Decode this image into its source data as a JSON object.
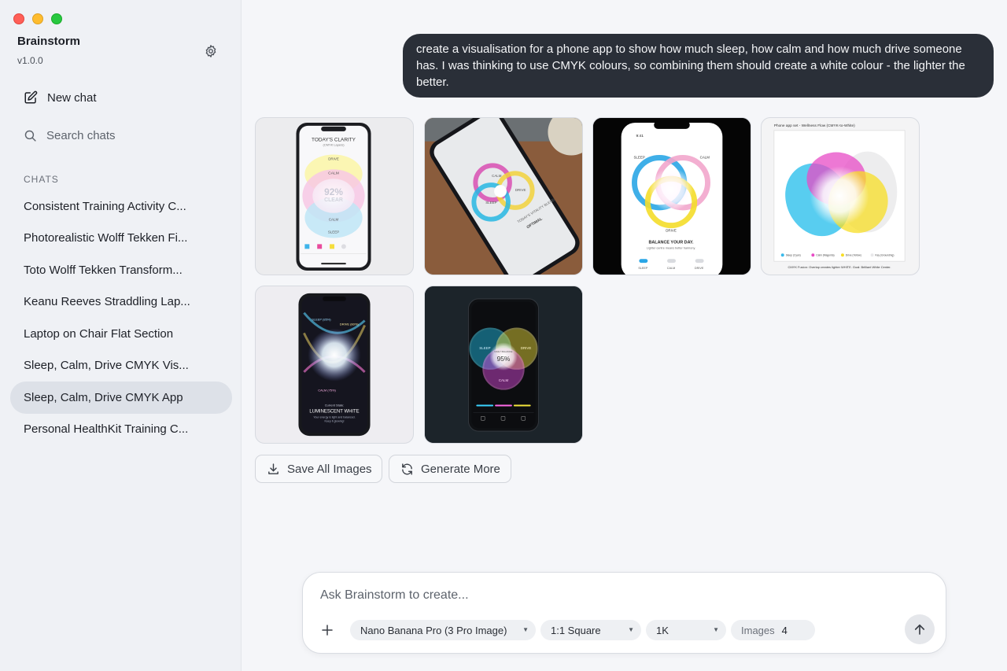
{
  "app": {
    "title": "Brainstorm",
    "version": "v1.0.0"
  },
  "sidebar": {
    "new_chat": "New chat",
    "search_chats": "Search chats",
    "chats_heading": "CHATS",
    "chats": [
      {
        "label": "Consistent Training Activity C..."
      },
      {
        "label": "Photorealistic Wolff Tekken Fi..."
      },
      {
        "label": "Toto Wolff Tekken Transform..."
      },
      {
        "label": "Keanu Reeves Straddling Lap..."
      },
      {
        "label": "Laptop on Chair Flat Section"
      },
      {
        "label": "Sleep, Calm, Drive CMYK Vis..."
      },
      {
        "label": "Sleep, Calm, Drive CMYK App",
        "active": true
      },
      {
        "label": "Personal HealthKit Training C..."
      }
    ]
  },
  "message": {
    "text": "create a visualisation for a phone app to show how much sleep, how calm and how much drive someone has. I was thinking to use CMYK colours, so combining them should create a white colour - the lighter the better."
  },
  "images": {
    "img1": {
      "title": "TODAY'S CLARITY",
      "subtitle": "(CMYK Layers)",
      "drive": "DRIVE",
      "calm": "CALM",
      "value": "92%",
      "value_label": "CLEAR",
      "calm2": "CALM",
      "sleep": "SLEEP"
    },
    "img2": {
      "calm": "CALM",
      "drive": "DRIVE",
      "sleep": "SLEEP",
      "caption": "TODAY'S VITALITY BLEND",
      "caption2": "OPTIMAL"
    },
    "img3": {
      "time": "9:41",
      "sleep": "SLEEP",
      "calm": "CALM",
      "drive": "DRIVE",
      "headline": "BALANCE YOUR DAY.",
      "sub": "Lighter centre means better harmony.",
      "toggle1": "SLEEP",
      "toggle2": "CALM",
      "toggle3": "DRIVE"
    },
    "img4": {
      "header": "Phone app set - Wellness Flow (CMYK-to-White)",
      "legend": [
        "Sleep (Cyan)",
        "Calm (Magenta)",
        "Drive (Yellow)",
        "Key (Grounding)"
      ],
      "footer": "CMYK Fusion: Overlap creates lighter WHITE. Goal: Brilliant White Center."
    },
    "img5": {
      "sleep": "SLEEP (85%)",
      "drive": "DRIVE (80%)",
      "calm": "CALM (75%)",
      "state_label": "Current State:",
      "state": "LUMINESCENT WHITE",
      "desc": "Your energy is light and balanced.",
      "desc2": "Keep it glowing!"
    },
    "img6": {
      "sleep": "SLEEP",
      "drive": "DRIVE",
      "calm": "CALM",
      "center_label": "DAILY BALANCE",
      "value": "95%"
    }
  },
  "actions": {
    "save_all": "Save All Images",
    "generate_more": "Generate More"
  },
  "composer": {
    "placeholder": "Ask Brainstorm to create...",
    "model": "Nano Banana Pro (3 Pro Image)",
    "aspect": "1:1 Square",
    "resolution": "1K",
    "images_label": "Images",
    "images_count": "4"
  }
}
